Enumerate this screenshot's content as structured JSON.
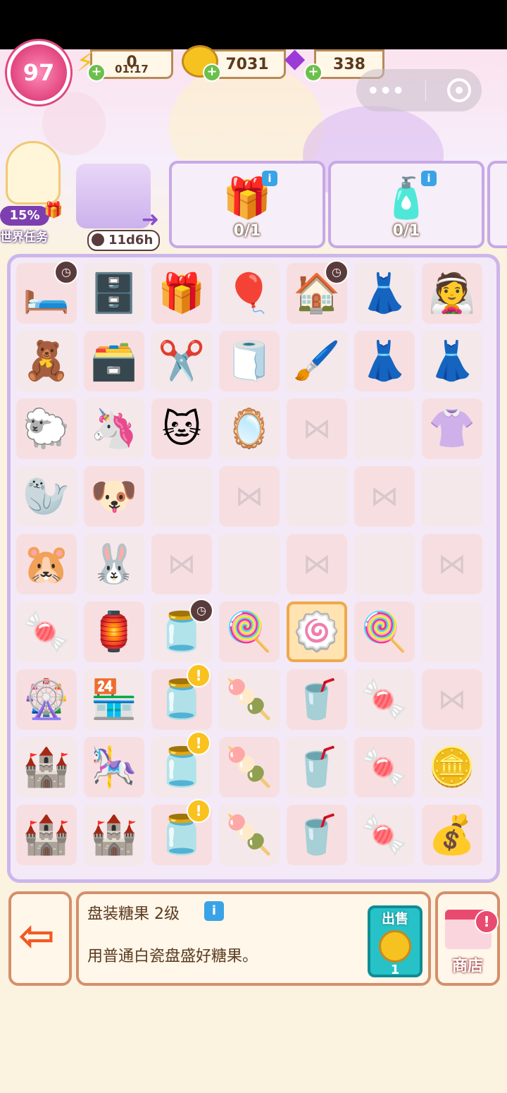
{
  "top_bar": {
    "level": "97",
    "energy": {
      "value": "0",
      "timer": "01:17"
    },
    "coins": {
      "value": "7031"
    },
    "gems": {
      "value": "338"
    }
  },
  "capsule": {
    "more_icon": "more-dots-icon",
    "close_icon": "target-circle-icon"
  },
  "world_task": {
    "percent": "15%",
    "label": "世界任务"
  },
  "event": {
    "timer": "11d6h"
  },
  "orders": [
    {
      "icon": "gift-box-icon",
      "glyph": "🎁",
      "progress": "0/1"
    },
    {
      "icon": "perfume-box-icon",
      "glyph": "🧴",
      "progress": "0/1"
    }
  ],
  "board": {
    "rows": [
      [
        {
          "name": "bed-set",
          "glyph": "🛏️",
          "badge": "clock"
        },
        {
          "name": "cabinet",
          "glyph": "🗄️"
        },
        {
          "name": "gift-box",
          "glyph": "🎁"
        },
        {
          "name": "balloons",
          "glyph": "🎈"
        },
        {
          "name": "house",
          "glyph": "🏠",
          "badge": "clock"
        },
        {
          "name": "purple-gown",
          "glyph": "👗"
        },
        {
          "name": "white-gown",
          "glyph": "👰"
        }
      ],
      [
        {
          "name": "teddy-bear",
          "glyph": "🧸"
        },
        {
          "name": "drawer-cabinet",
          "glyph": "🗃️"
        },
        {
          "name": "craft-paper",
          "glyph": "✂️"
        },
        {
          "name": "lint-roller",
          "glyph": "🧻"
        },
        {
          "name": "makeup-brush",
          "glyph": "🖌️"
        },
        {
          "name": "purple-dress",
          "glyph": "👗"
        },
        {
          "name": "purple-dress-2",
          "glyph": "👗"
        }
      ],
      [
        {
          "name": "sheep-plush",
          "glyph": "🐑"
        },
        {
          "name": "unicorn-plush",
          "glyph": "🦄"
        },
        {
          "name": "cat-plush",
          "glyph": "🐱"
        },
        {
          "name": "hand-mirror",
          "glyph": "🪞"
        },
        {
          "name": "empty",
          "bow": true
        },
        {
          "name": "empty"
        },
        {
          "name": "purple-skirt",
          "glyph": "👚"
        }
      ],
      [
        {
          "name": "seal-plush",
          "glyph": "🦭"
        },
        {
          "name": "puppy-plush",
          "glyph": "🐶"
        },
        {
          "name": "empty"
        },
        {
          "name": "empty",
          "bow": true
        },
        {
          "name": "empty"
        },
        {
          "name": "empty",
          "bow": true
        },
        {
          "name": "empty"
        }
      ],
      [
        {
          "name": "hamster-plush",
          "glyph": "🐹"
        },
        {
          "name": "bunny-plush",
          "glyph": "🐰"
        },
        {
          "name": "empty",
          "bow": true
        },
        {
          "name": "empty"
        },
        {
          "name": "empty",
          "bow": true
        },
        {
          "name": "empty"
        },
        {
          "name": "empty",
          "bow": true
        }
      ],
      [
        {
          "name": "wrapped-candy",
          "glyph": "🍬"
        },
        {
          "name": "candy-machine-glow",
          "glyph": "🏮"
        },
        {
          "name": "candy-jar",
          "glyph": "🫙",
          "badge": "clock"
        },
        {
          "name": "candy-bag",
          "glyph": "🍭"
        },
        {
          "name": "plated-candy",
          "glyph": "🍥",
          "selected": true
        },
        {
          "name": "lollipop",
          "glyph": "🍭"
        },
        {
          "name": "empty"
        }
      ],
      [
        {
          "name": "carousel-swing",
          "glyph": "🎡"
        },
        {
          "name": "candy-booth",
          "glyph": "🏪"
        },
        {
          "name": "glass-jar",
          "glyph": "🫙",
          "badge": "excl"
        },
        {
          "name": "cotton-candy",
          "glyph": "🍡"
        },
        {
          "name": "matcha-drink",
          "glyph": "🥤"
        },
        {
          "name": "marshmallow",
          "glyph": "🍬"
        },
        {
          "name": "empty",
          "bow": true
        }
      ],
      [
        {
          "name": "pink-castle",
          "glyph": "🏰"
        },
        {
          "name": "teacup-ride",
          "glyph": "🎠"
        },
        {
          "name": "glass-jar-2",
          "glyph": "🫙",
          "badge": "excl"
        },
        {
          "name": "cotton-candy-2",
          "glyph": "🍡"
        },
        {
          "name": "matcha-drink-2",
          "glyph": "🥤"
        },
        {
          "name": "marshmallow-2",
          "glyph": "🍬"
        },
        {
          "name": "coins-small",
          "glyph": "🪙"
        }
      ],
      [
        {
          "name": "pink-castle-2",
          "glyph": "🏰"
        },
        {
          "name": "pink-castle-3",
          "glyph": "🏰"
        },
        {
          "name": "glass-jar-3",
          "glyph": "🫙",
          "badge": "excl"
        },
        {
          "name": "cotton-candy-3",
          "glyph": "🍡"
        },
        {
          "name": "matcha-drink-3",
          "glyph": "🥤"
        },
        {
          "name": "marshmallow-3",
          "glyph": "🍬"
        },
        {
          "name": "coins-pile",
          "glyph": "💰"
        }
      ]
    ]
  },
  "info_panel": {
    "title": "盘装糖果 2级",
    "description": "用普通白瓷盘盛好糖果。",
    "sell_label": "出售",
    "sell_price": "1"
  },
  "shop": {
    "label": "商店"
  },
  "colors": {
    "board_border": "#cdb6ec",
    "panel_border": "#d58f6c",
    "sell_button": "#26c2c8",
    "level_badge": "#e2457f"
  }
}
